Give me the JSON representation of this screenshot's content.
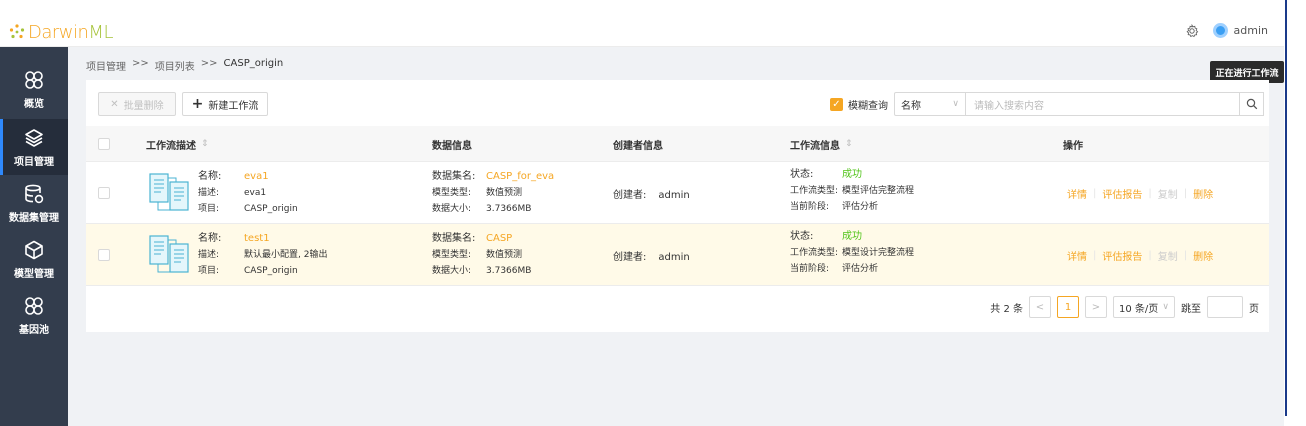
{
  "app": {
    "logo_darwin": "Darwin",
    "logo_ml": "ML",
    "username": "admin"
  },
  "sidebar": {
    "items": [
      {
        "label": "概览",
        "icon": "overview-icon"
      },
      {
        "label": "项目管理",
        "icon": "layers-icon"
      },
      {
        "label": "数据集管理",
        "icon": "database-icon"
      },
      {
        "label": "模型管理",
        "icon": "cube-icon"
      },
      {
        "label": "基因池",
        "icon": "gene-pool-icon"
      }
    ],
    "active_index": 1
  },
  "breadcrumb": {
    "items": [
      "项目管理",
      "项目列表",
      "CASP_origin"
    ],
    "separator": ">>"
  },
  "tooltip": "正在进行工作流",
  "toolbar": {
    "batch_delete": "批量删除",
    "new_workflow": "新建工作流"
  },
  "search": {
    "fuzzy_label": "模糊查询",
    "fuzzy_checked": true,
    "field": "名称",
    "placeholder": "请输入搜索内容"
  },
  "table": {
    "headers": {
      "desc": "工作流描述",
      "data": "数据信息",
      "creator": "创建者信息",
      "workflow": "工作流信息",
      "ops": "操作"
    },
    "rows": [
      {
        "name_k": "名称:",
        "name": "eva1",
        "desc_k": "描述:",
        "desc": "eva1",
        "proj_k": "项目:",
        "proj": "CASP_origin",
        "dataset_k": "数据集名:",
        "dataset": "CASP_for_eva",
        "mtype_k": "模型类型:",
        "mtype": "数值预测",
        "size_k": "数据大小:",
        "size": "3.7366MB",
        "creator_k": "创建者:",
        "creator": "admin",
        "status_k": "状态:",
        "status": "成功",
        "wtype_k": "工作流类型:",
        "wtype": "模型评估完整流程",
        "stage_k": "当前阶段:",
        "stage": "评估分析",
        "ops": [
          "详情",
          "评估报告",
          "复制",
          "删除"
        ],
        "highlight": false
      },
      {
        "name_k": "名称:",
        "name": "test1",
        "desc_k": "描述:",
        "desc": "默认最小配置, 2输出",
        "proj_k": "项目:",
        "proj": "CASP_origin",
        "dataset_k": "数据集名:",
        "dataset": "CASP",
        "mtype_k": "模型类型:",
        "mtype": "数值预测",
        "size_k": "数据大小:",
        "size": "3.7366MB",
        "creator_k": "创建者:",
        "creator": "admin",
        "status_k": "状态:",
        "status": "成功",
        "wtype_k": "工作流类型:",
        "wtype": "模型设计完整流程",
        "stage_k": "当前阶段:",
        "stage": "评估分析",
        "ops": [
          "详情",
          "评估报告",
          "复制",
          "删除"
        ],
        "highlight": true
      }
    ]
  },
  "pagination": {
    "total": "共 2 条",
    "prev": "<",
    "current": "1",
    "next": ">",
    "page_size": "10 条/页",
    "jump": "跳至",
    "page_unit": "页"
  },
  "colors": {
    "accent": "#f5a623",
    "success": "#52c41a",
    "sidebar": "#333d4d",
    "sidebar_active": "#252d3b"
  }
}
